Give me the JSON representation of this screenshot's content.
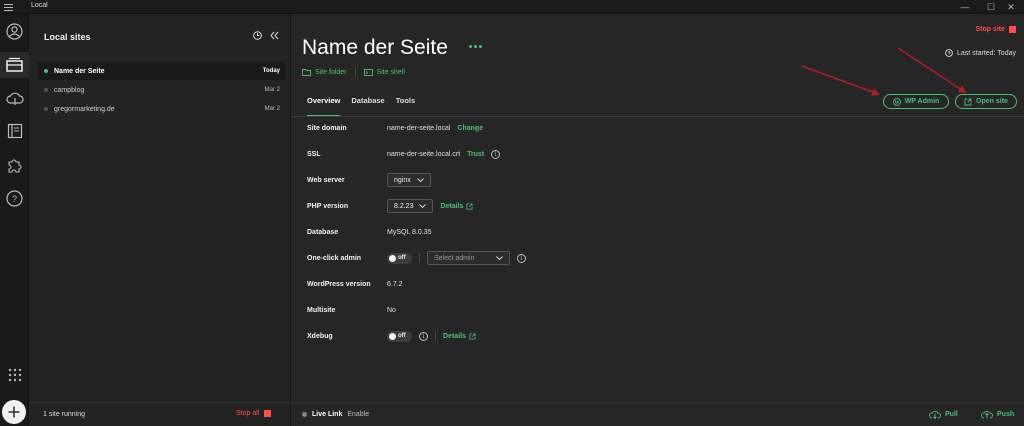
{
  "window": {
    "title": "Local",
    "minimize": "—",
    "maximize": "☐",
    "close": "✕"
  },
  "sidebar": {
    "title": "Local sites",
    "sites": [
      {
        "name": "Name der Seite",
        "date": "Today",
        "running": true
      },
      {
        "name": "campblog",
        "date": "Mar 2",
        "running": false
      },
      {
        "name": "gregormarketing.de",
        "date": "Mar 2",
        "running": false
      }
    ],
    "running_text": "1 site running",
    "stop_all": "Stop all"
  },
  "site": {
    "title": "Name der Seite",
    "site_folder": "Site folder",
    "site_shell": "Site shell",
    "stop_site": "Stop site",
    "last_started": "Last started: Today",
    "tabs": [
      "Overview",
      "Database",
      "Tools"
    ],
    "wp_admin": "WP Admin",
    "open_site": "Open site"
  },
  "overview": {
    "site_domain": {
      "label": "Site domain",
      "value": "name-der-seite.local",
      "action": "Change"
    },
    "ssl": {
      "label": "SSL",
      "value": "name-der-seite.local.crt",
      "action": "Trust"
    },
    "web_server": {
      "label": "Web server",
      "value": "nginx"
    },
    "php_version": {
      "label": "PHP version",
      "value": "8.2.23",
      "action": "Details"
    },
    "database": {
      "label": "Database",
      "value": "MySQL 8.0.35"
    },
    "one_click_admin": {
      "label": "One-click admin",
      "toggle": "off",
      "placeholder": "Select admin"
    },
    "wordpress_version": {
      "label": "WordPress version",
      "value": "6.7.2"
    },
    "multisite": {
      "label": "Multisite",
      "value": "No"
    },
    "xdebug": {
      "label": "Xdebug",
      "toggle": "off",
      "action": "Details"
    }
  },
  "footer": {
    "live_link": "Live Link",
    "enable": "Enable",
    "pull": "Pull",
    "push": "Push"
  },
  "colors": {
    "accent": "#51bb7b",
    "danger": "#ff4d4d",
    "annotation": "#b01e2a"
  }
}
